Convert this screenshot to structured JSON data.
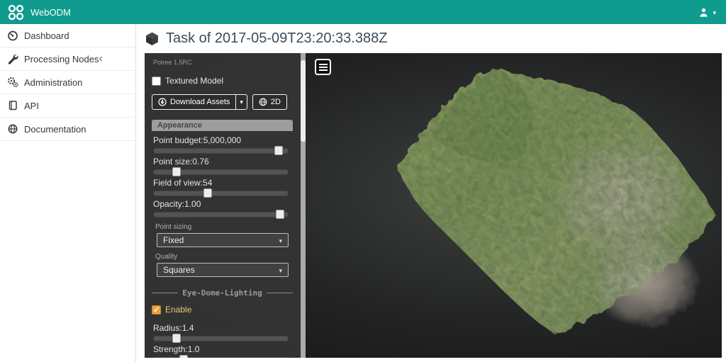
{
  "colors": {
    "brand": "#0f9b8e",
    "accent_orange": "#e8a33d",
    "panel_bg": "#343434"
  },
  "topbar": {
    "brand": "WebODM"
  },
  "sidebar": {
    "items": [
      {
        "label": "Dashboard"
      },
      {
        "label": "Processing Nodes"
      },
      {
        "label": "Administration"
      },
      {
        "label": "API"
      },
      {
        "label": "Documentation"
      }
    ]
  },
  "main": {
    "title": "Task of 2017-05-09T23:20:33.388Z"
  },
  "potree": {
    "version": "Potree 1.5RC",
    "textured_model_label": "Textured Model",
    "textured_model_checked": false,
    "download_assets_label": "Download Assets",
    "view_2d_label": "2D",
    "appearance_header": "Appearance",
    "sliders": [
      {
        "label": "Point budget:5,000,000",
        "pos": "93%"
      },
      {
        "label": "Point size:0.76",
        "pos": "17%"
      },
      {
        "label": "Field of view:54",
        "pos": "40%"
      },
      {
        "label": "Opacity:1.00",
        "pos": "94%"
      }
    ],
    "point_sizing_label": "Point sizing",
    "point_sizing_value": "Fixed",
    "quality_label": "Quality",
    "quality_value": "Squares",
    "edl_header": "Eye-Dome-Lighting",
    "enable_label": "Enable",
    "enable_checked": true,
    "edl_sliders": [
      {
        "label": "Radius:1.4",
        "pos": "17%"
      },
      {
        "label": "Strength:1.0",
        "pos": "22%"
      }
    ]
  }
}
